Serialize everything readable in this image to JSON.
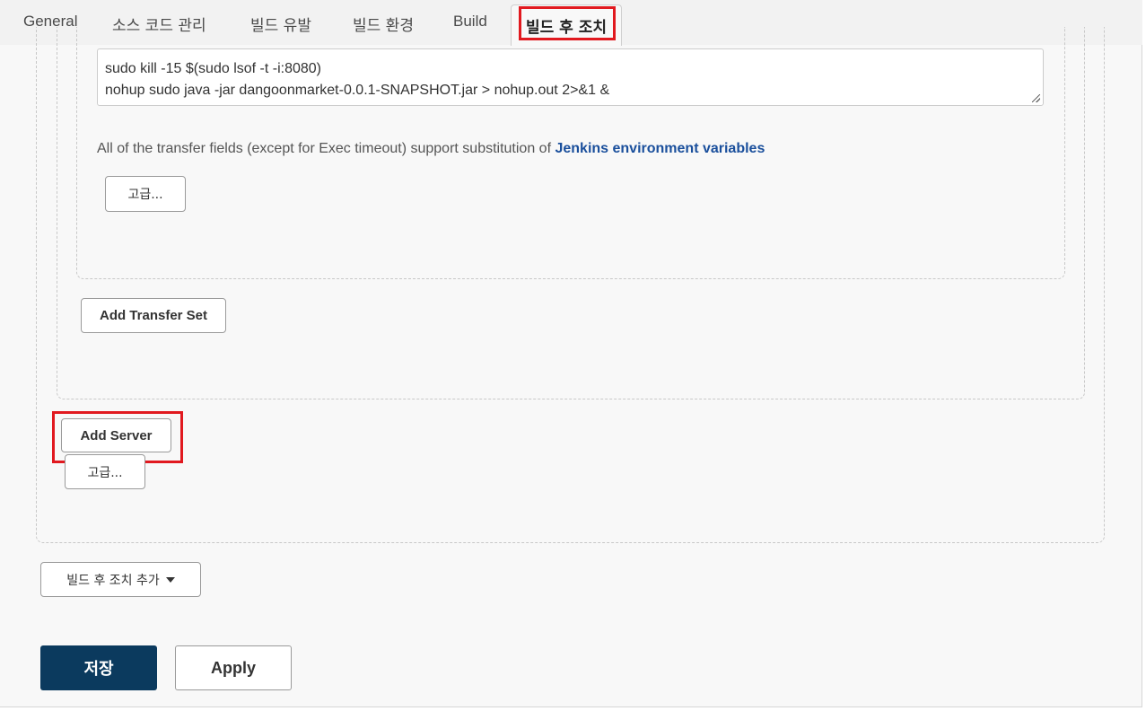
{
  "tabs": [
    {
      "label": "General"
    },
    {
      "label": "소스 코드 관리"
    },
    {
      "label": "빌드 유발"
    },
    {
      "label": "빌드 환경"
    },
    {
      "label": "Build"
    },
    {
      "label": "빌드 후 조치",
      "active": true
    }
  ],
  "exec_command": {
    "line1": "sudo kill -15 $(sudo lsof -t -i:8080)",
    "line2": "nohup sudo java -jar dangoonmarket-0.0.1-SNAPSHOT.jar > nohup.out 2>&1 &"
  },
  "help": {
    "text": "All of the transfer fields (except for Exec timeout) support substitution of ",
    "link": "Jenkins environment variables"
  },
  "buttons": {
    "advanced": "고급...",
    "add_transfer_set": "Add Transfer Set",
    "add_server": "Add Server",
    "advanced_2": "고급...",
    "add_post_build": "빌드 후 조치 추가",
    "save": "저장",
    "apply": "Apply"
  },
  "highlight_color": "#e1191f",
  "save_button_color": "#0b3a5e",
  "link_color": "#1a4f9c"
}
